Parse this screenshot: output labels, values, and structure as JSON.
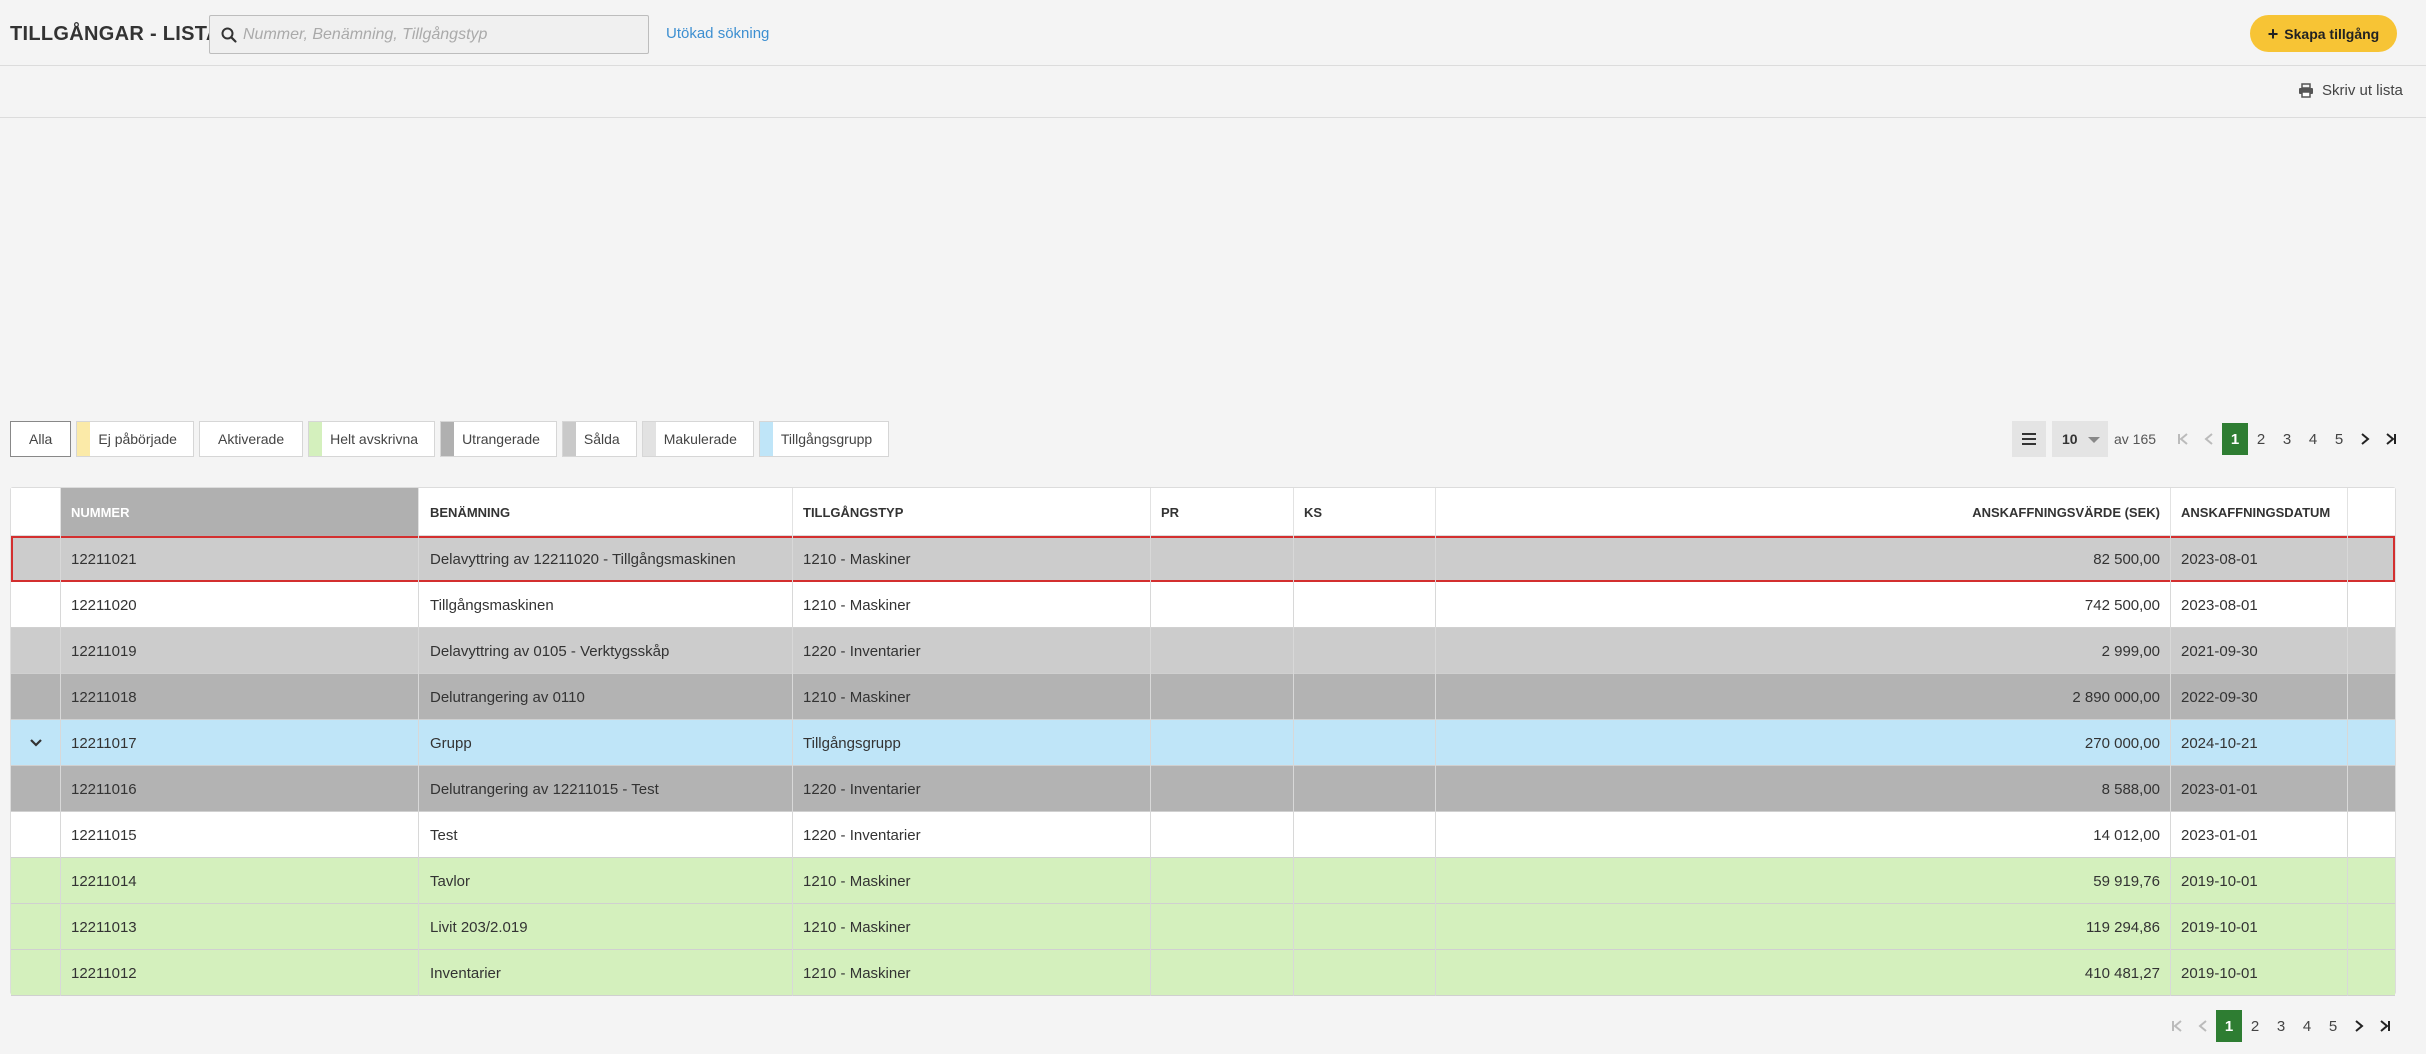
{
  "header": {
    "title": "TILLGÅNGAR - LISTA",
    "search_placeholder": "Nummer, Benämning, Tillgångstyp",
    "advanced_search": "Utökad sökning",
    "create_button": "Skapa tillgång"
  },
  "toolbar": {
    "print_label": "Skriv ut lista"
  },
  "filters": [
    {
      "label": "Alla",
      "color": ""
    },
    {
      "label": "Ej påbörjade",
      "color": "#fbeaa8"
    },
    {
      "label": "Aktiverade",
      "color": ""
    },
    {
      "label": "Helt avskrivna",
      "color": "#d4f0bd"
    },
    {
      "label": "Utrangerade",
      "color": "#b0b0b0"
    },
    {
      "label": "Sålda",
      "color": "#c9c9c9"
    },
    {
      "label": "Makulerade",
      "color": "#e2e2e2"
    },
    {
      "label": "Tillgångsgrupp",
      "color": "#bfe5f8"
    }
  ],
  "pagination": {
    "page_size": "10",
    "of_text": "av 165",
    "pages": [
      "1",
      "2",
      "3",
      "4",
      "5"
    ],
    "current": "1"
  },
  "table": {
    "columns": [
      "NUMMER",
      "BENÄMNING",
      "TILLGÅNGSTYP",
      "PR",
      "KS",
      "ANSKAFFNINGSVÄRDE (SEK)",
      "ANSKAFFNINGSDATUM"
    ],
    "rows": [
      {
        "nummer": "12211021",
        "benamning": "Delavyttring av 12211020 - Tillgångsmaskinen",
        "typ": "1210 - Maskiner",
        "pr": "",
        "ks": "",
        "varde": "82 500,00",
        "datum": "2023-08-01",
        "bg": "#cccccc",
        "selected": true,
        "expand": false
      },
      {
        "nummer": "12211020",
        "benamning": "Tillgångsmaskinen",
        "typ": "1210 - Maskiner",
        "pr": "",
        "ks": "",
        "varde": "742 500,00",
        "datum": "2023-08-01",
        "bg": "#ffffff",
        "selected": false,
        "expand": false
      },
      {
        "nummer": "12211019",
        "benamning": "Delavyttring av 0105 - Verktygsskåp",
        "typ": "1220 - Inventarier",
        "pr": "",
        "ks": "",
        "varde": "2 999,00",
        "datum": "2021-09-30",
        "bg": "#cccccc",
        "selected": false,
        "expand": false
      },
      {
        "nummer": "12211018",
        "benamning": "Delutrangering av 0110",
        "typ": "1210 - Maskiner",
        "pr": "",
        "ks": "",
        "varde": "2 890 000,00",
        "datum": "2022-09-30",
        "bg": "#b3b3b3",
        "selected": false,
        "expand": false
      },
      {
        "nummer": "12211017",
        "benamning": "Grupp",
        "typ": "Tillgångsgrupp",
        "pr": "",
        "ks": "",
        "varde": "270 000,00",
        "datum": "2024-10-21",
        "bg": "#bfe5f8",
        "selected": false,
        "expand": true
      },
      {
        "nummer": "12211016",
        "benamning": "Delutrangering av 12211015 - Test",
        "typ": "1220 - Inventarier",
        "pr": "",
        "ks": "",
        "varde": "8 588,00",
        "datum": "2023-01-01",
        "bg": "#b3b3b3",
        "selected": false,
        "expand": false
      },
      {
        "nummer": "12211015",
        "benamning": "Test",
        "typ": "1220 - Inventarier",
        "pr": "",
        "ks": "",
        "varde": "14 012,00",
        "datum": "2023-01-01",
        "bg": "#ffffff",
        "selected": false,
        "expand": false
      },
      {
        "nummer": "12211014",
        "benamning": "Tavlor",
        "typ": "1210 - Maskiner",
        "pr": "",
        "ks": "",
        "varde": "59 919,76",
        "datum": "2019-10-01",
        "bg": "#d4f0bd",
        "selected": false,
        "expand": false
      },
      {
        "nummer": "12211013",
        "benamning": "Livit 203/2.019",
        "typ": "1210 - Maskiner",
        "pr": "",
        "ks": "",
        "varde": "119 294,86",
        "datum": "2019-10-01",
        "bg": "#d4f0bd",
        "selected": false,
        "expand": false
      },
      {
        "nummer": "12211012",
        "benamning": "Inventarier",
        "typ": "1210 - Maskiner",
        "pr": "",
        "ks": "",
        "varde": "410 481,27",
        "datum": "2019-10-01",
        "bg": "#d4f0bd",
        "selected": false,
        "expand": false
      }
    ]
  }
}
